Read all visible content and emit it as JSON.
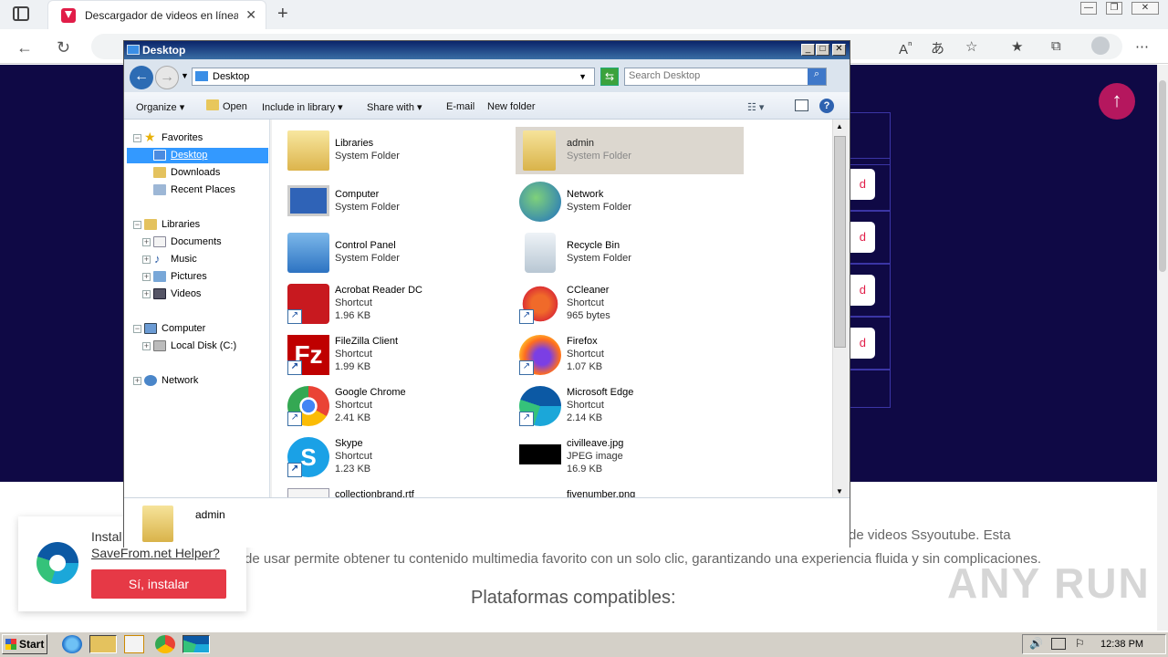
{
  "browser": {
    "tab_title": "Descargador de videos en línea",
    "tab_close": "✕",
    "new_tab": "+",
    "win_min": "—",
    "win_max": "❐",
    "win_close": "✕"
  },
  "page": {
    "up_arrow": "↑",
    "btn_letter": "d",
    "desc_line1": "de videos Ssyoutube. Esta",
    "desc_line2": "de usar permite obtener tu contenido multimedia favorito con un solo clic, garantizando una experiencia fluida y sin complicaciones.",
    "platforms_heading": "Plataformas compatibles:",
    "watermark": "ANY RUN"
  },
  "popup": {
    "text": "Instal",
    "link": "SaveFrom.net Helper?",
    "button": "Sí, instalar"
  },
  "explorer": {
    "title": "Desktop",
    "path": "Desktop",
    "search_placeholder": "Search Desktop",
    "commands": [
      "Organize",
      "Open",
      "Include in library",
      "Share with",
      "E-mail",
      "New folder"
    ],
    "nav": {
      "favorites": "Favorites",
      "desktop": "Desktop",
      "downloads": "Downloads",
      "recent": "Recent Places",
      "libraries": "Libraries",
      "documents": "Documents",
      "music": "Music",
      "pictures": "Pictures",
      "videos": "Videos",
      "computer": "Computer",
      "local_disk": "Local Disk (C:)",
      "network": "Network"
    },
    "items": [
      {
        "name": "Libraries",
        "type": "System Folder",
        "size": ""
      },
      {
        "name": "admin",
        "type": "System Folder",
        "size": ""
      },
      {
        "name": "Computer",
        "type": "System Folder",
        "size": ""
      },
      {
        "name": "Network",
        "type": "System Folder",
        "size": ""
      },
      {
        "name": "Control Panel",
        "type": "System Folder",
        "size": ""
      },
      {
        "name": "Recycle Bin",
        "type": "System Folder",
        "size": ""
      },
      {
        "name": "Acrobat Reader DC",
        "type": "Shortcut",
        "size": "1.96 KB"
      },
      {
        "name": "CCleaner",
        "type": "Shortcut",
        "size": "965 bytes"
      },
      {
        "name": "FileZilla Client",
        "type": "Shortcut",
        "size": "1.99 KB"
      },
      {
        "name": "Firefox",
        "type": "Shortcut",
        "size": "1.07 KB"
      },
      {
        "name": "Google Chrome",
        "type": "Shortcut",
        "size": "2.41 KB"
      },
      {
        "name": "Microsoft Edge",
        "type": "Shortcut",
        "size": "2.14 KB"
      },
      {
        "name": "Skype",
        "type": "Shortcut",
        "size": "1.23 KB"
      },
      {
        "name": "civilleave.jpg",
        "type": "JPEG image",
        "size": "16.9 KB"
      },
      {
        "name": "collectionbrand.rtf",
        "type": "",
        "size": ""
      },
      {
        "name": "fivenumber.png",
        "type": "",
        "size": ""
      }
    ],
    "details_name": "admin"
  },
  "taskbar": {
    "start": "Start",
    "clock": "12:38 PM"
  },
  "colors": {
    "page_dark": "#0f0945",
    "accent_pink": "#b5175e",
    "install_button": "#e63946",
    "selection": "#3399ff"
  }
}
